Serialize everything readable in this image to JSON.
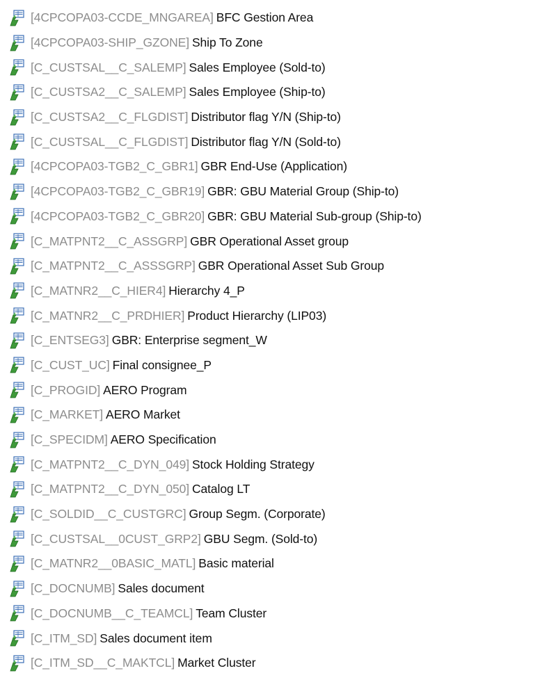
{
  "colors": {
    "tech_name": "#8d8d8d",
    "description": "#111111",
    "icon_green": "#3f9a3a",
    "icon_blue": "#3b6fb6"
  },
  "tree": {
    "items": [
      {
        "tech": "[4CPCOPA03-CCDE_MNGAREA]",
        "desc": "BFC Gestion Area",
        "icon": "characteristic-icon"
      },
      {
        "tech": "[4CPCOPA03-SHIP_GZONE]",
        "desc": "Ship To Zone",
        "icon": "characteristic-icon"
      },
      {
        "tech": "[C_CUSTSAL__C_SALEMP]",
        "desc": "Sales Employee (Sold-to)",
        "icon": "characteristic-icon"
      },
      {
        "tech": "[C_CUSTSA2__C_SALEMP]",
        "desc": "Sales Employee (Ship-to)",
        "icon": "characteristic-icon"
      },
      {
        "tech": "[C_CUSTSA2__C_FLGDIST]",
        "desc": "Distributor flag Y/N (Ship-to)",
        "icon": "characteristic-icon"
      },
      {
        "tech": "[C_CUSTSAL__C_FLGDIST]",
        "desc": "Distributor flag Y/N (Sold-to)",
        "icon": "characteristic-icon"
      },
      {
        "tech": "[4CPCOPA03-TGB2_C_GBR1]",
        "desc": "GBR End-Use (Application)",
        "icon": "characteristic-icon"
      },
      {
        "tech": "[4CPCOPA03-TGB2_C_GBR19]",
        "desc": "GBR: GBU Material  Group (Ship-to)",
        "icon": "characteristic-icon"
      },
      {
        "tech": "[4CPCOPA03-TGB2_C_GBR20]",
        "desc": "GBR: GBU Material  Sub-group (Ship-to)",
        "icon": "characteristic-icon"
      },
      {
        "tech": "[C_MATPNT2__C_ASSGRP]",
        "desc": "GBR Operational Asset group",
        "icon": "characteristic-icon"
      },
      {
        "tech": "[C_MATPNT2__C_ASSSGRP]",
        "desc": "GBR Operational Asset Sub Group",
        "icon": "characteristic-icon"
      },
      {
        "tech": "[C_MATNR2__C_HIER4]",
        "desc": "Hierarchy 4_P",
        "icon": "characteristic-icon"
      },
      {
        "tech": "[C_MATNR2__C_PRDHIER]",
        "desc": "Product Hierarchy (LIP03)",
        "icon": "characteristic-icon"
      },
      {
        "tech": "[C_ENTSEG3]",
        "desc": "GBR: Enterprise segment_W",
        "icon": "characteristic-icon"
      },
      {
        "tech": "[C_CUST_UC]",
        "desc": "Final consignee_P",
        "icon": "characteristic-icon"
      },
      {
        "tech": "[C_PROGID]",
        "desc": "AERO Program",
        "icon": "characteristic-icon"
      },
      {
        "tech": "[C_MARKET]",
        "desc": "AERO Market",
        "icon": "characteristic-icon"
      },
      {
        "tech": "[C_SPECIDM]",
        "desc": "AERO Specification",
        "icon": "characteristic-icon"
      },
      {
        "tech": "[C_MATPNT2__C_DYN_049]",
        "desc": "Stock Holding Strategy",
        "icon": "characteristic-icon"
      },
      {
        "tech": "[C_MATPNT2__C_DYN_050]",
        "desc": "Catalog LT",
        "icon": "characteristic-icon"
      },
      {
        "tech": "[C_SOLDID__C_CUSTGRC]",
        "desc": "Group Segm. (Corporate)",
        "icon": "characteristic-icon"
      },
      {
        "tech": "[C_CUSTSAL__0CUST_GRP2]",
        "desc": "GBU Segm. (Sold-to)",
        "icon": "characteristic-icon"
      },
      {
        "tech": "[C_MATNR2__0BASIC_MATL]",
        "desc": "Basic material",
        "icon": "characteristic-icon"
      },
      {
        "tech": "[C_DOCNUMB]",
        "desc": "Sales document",
        "icon": "characteristic-icon"
      },
      {
        "tech": "[C_DOCNUMB__C_TEAMCL]",
        "desc": "Team Cluster",
        "icon": "characteristic-icon"
      },
      {
        "tech": "[C_ITM_SD]",
        "desc": "Sales document item",
        "icon": "characteristic-icon"
      },
      {
        "tech": "[C_ITM_SD__C_MAKTCL]",
        "desc": "Market Cluster",
        "icon": "characteristic-icon"
      }
    ]
  }
}
